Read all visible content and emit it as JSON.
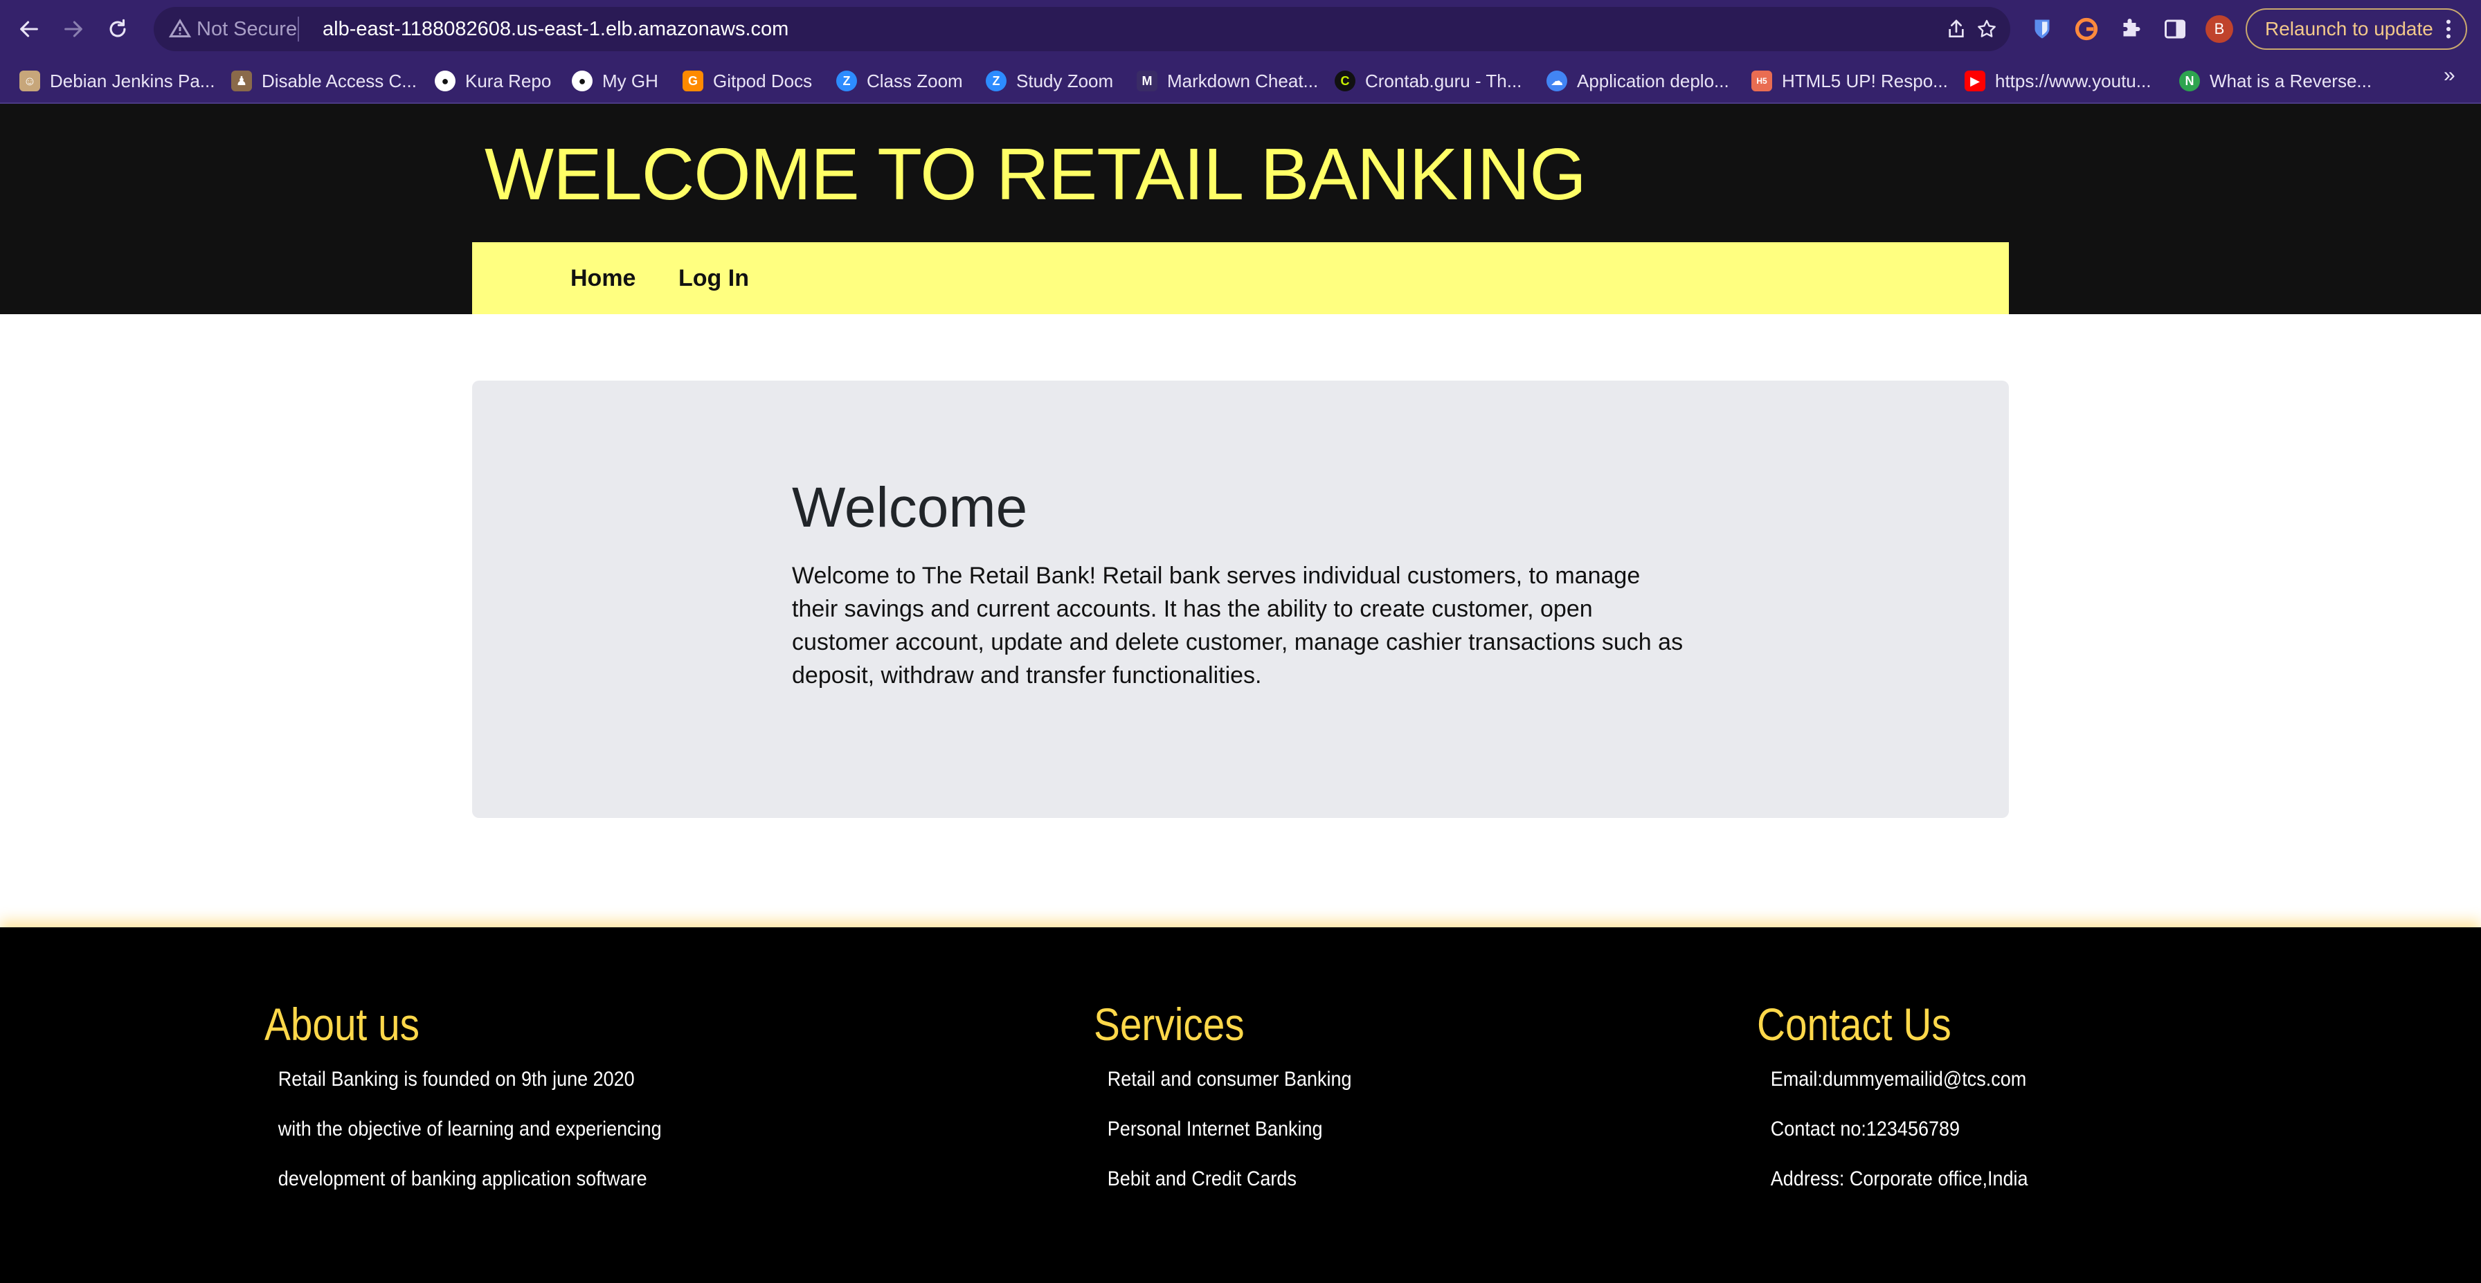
{
  "browser": {
    "security_label": "Not Secure",
    "url": "alb-east-1188082608.us-east-1.elb.amazonaws.com",
    "profile_initial": "B",
    "relaunch_label": "Relaunch to update",
    "bookmarks": [
      {
        "label": "Debian Jenkins Pa...",
        "icon": "debian-icon",
        "color": "#c7a67a"
      },
      {
        "label": "Disable Access C...",
        "icon": "person-icon",
        "color": "#8a6a4a"
      },
      {
        "label": "Kura Repo",
        "icon": "github-icon",
        "color": "#ffffff"
      },
      {
        "label": "My GH",
        "icon": "github-icon",
        "color": "#ffffff"
      },
      {
        "label": "Gitpod Docs",
        "icon": "gitpod-icon",
        "color": "#ff8a00"
      },
      {
        "label": "Class Zoom",
        "icon": "zoom-icon",
        "color": "#2d8cff"
      },
      {
        "label": "Study Zoom",
        "icon": "zoom-icon",
        "color": "#2d8cff"
      },
      {
        "label": "Markdown Cheat...",
        "icon": "markdown-icon",
        "color": "#3a2c66"
      },
      {
        "label": "Crontab.guru - Th...",
        "icon": "crontab-icon",
        "color": "#111111"
      },
      {
        "label": "Application deplo...",
        "icon": "google-cloud-icon",
        "color": "#4285f4"
      },
      {
        "label": "HTML5 UP! Respo...",
        "icon": "html5up-icon",
        "color": "#e96d52"
      },
      {
        "label": "https://www.youtu...",
        "icon": "youtube-icon",
        "color": "#ff0000"
      },
      {
        "label": "What is a Reverse...",
        "icon": "n-icon",
        "color": "#2ea44f"
      }
    ],
    "more_label": "»"
  },
  "site": {
    "title": "WELCOME TO RETAIL BANKING",
    "nav": {
      "home": "Home",
      "login": "Log In"
    },
    "welcome": {
      "heading": "Welcome",
      "text": "Welcome to The Retail Bank! Retail bank serves individual customers, to manage their savings and current accounts. It has the ability to create customer, open customer account, update and delete customer, manage cashier transactions such as deposit, withdraw and transfer functionalities."
    }
  },
  "footer": {
    "about": {
      "heading": "About us",
      "lines": [
        "Retail Banking is founded on 9th june 2020",
        "with the objective of learning and experiencing",
        "development of banking application software"
      ]
    },
    "services": {
      "heading": "Services",
      "lines": [
        "Retail and consumer Banking",
        "Personal Internet Banking",
        "Bebit and Credit Cards"
      ]
    },
    "contact": {
      "heading": "Contact Us",
      "lines": [
        "Email:dummyemailid@tcs.com",
        "Contact no:123456789",
        "Address: Corporate office,India"
      ]
    }
  },
  "colors": {
    "chrome_bg": "#35226b",
    "hero_bg": "#111111",
    "title_yellow": "#ffff66",
    "nav_yellow": "#ffff80",
    "panel_bg": "#e9eaee",
    "footer_heading": "#ffd84a"
  }
}
